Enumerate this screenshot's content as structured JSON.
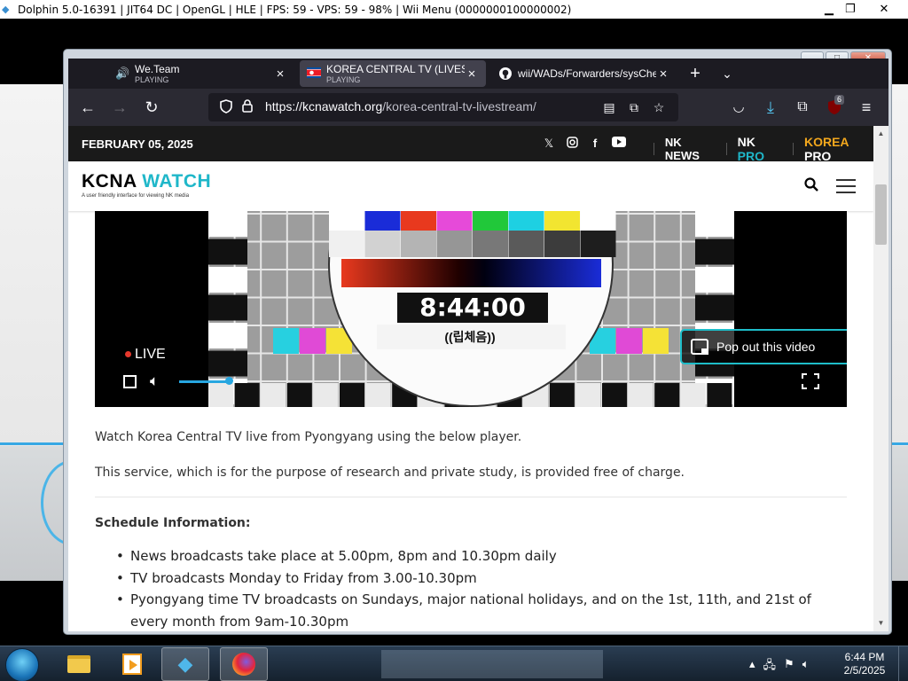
{
  "dolphin": {
    "title": "Dolphin 5.0-16391 | JIT64 DC | OpenGL | HLE | FPS: 59 - VPS: 59 - 98% | Wii Menu (0000000100000002)",
    "icon": "dolphin-icon"
  },
  "tabs": [
    {
      "label": "We.Team",
      "sub": "PLAYING",
      "icon": "audio-playing-icon",
      "active": false
    },
    {
      "label": "KOREA CENTRAL TV (LIVESTREAM)",
      "sub": "PLAYING",
      "icon": "north-korea-flag-icon",
      "active": true
    },
    {
      "label": "wii/WADs/Forwarders/sysCheck",
      "sub": "",
      "icon": "github-icon",
      "active": false
    }
  ],
  "url": {
    "host": "https://kcnawatch.org",
    "path": "/korea-central-tv-livestream/"
  },
  "extensions_badge": "6",
  "site": {
    "date": "FEBRUARY 05, 2025",
    "social": [
      "x-icon",
      "instagram-icon",
      "facebook-icon",
      "youtube-icon"
    ],
    "nknews": "NK NEWS",
    "nkpro_a": "NK",
    "nkpro_b": "PRO",
    "koreapro_a": "KOREA",
    "koreapro_b": "PRO",
    "logo_a": "KCNA",
    "logo_b": "WATCH",
    "tagline": "A user friendly interface for viewing NK media"
  },
  "player": {
    "time": "8:44:00",
    "sub": "((립체음))",
    "live": "LIVE",
    "popout": "Pop out this video",
    "volume": 0.8
  },
  "article": {
    "intro1": "Watch Korea Central TV live from Pyongyang using the below player.",
    "intro2": "This service, which is for the purpose of research and private study, is provided free of charge.",
    "schedule_heading": "Schedule Information:",
    "schedule": [
      "News broadcasts take place at 5.00pm, 8pm and 10.30pm daily",
      "TV broadcasts Monday to Friday from 3.00-10.30pm",
      "Pyongyang time TV broadcasts on Sundays, major national holidays, and on the 1st, 11th, and 21st of every month from 9am-10.30pm"
    ]
  },
  "taskbar": {
    "clock_time": "6:44 PM",
    "clock_date": "2/5/2025"
  }
}
